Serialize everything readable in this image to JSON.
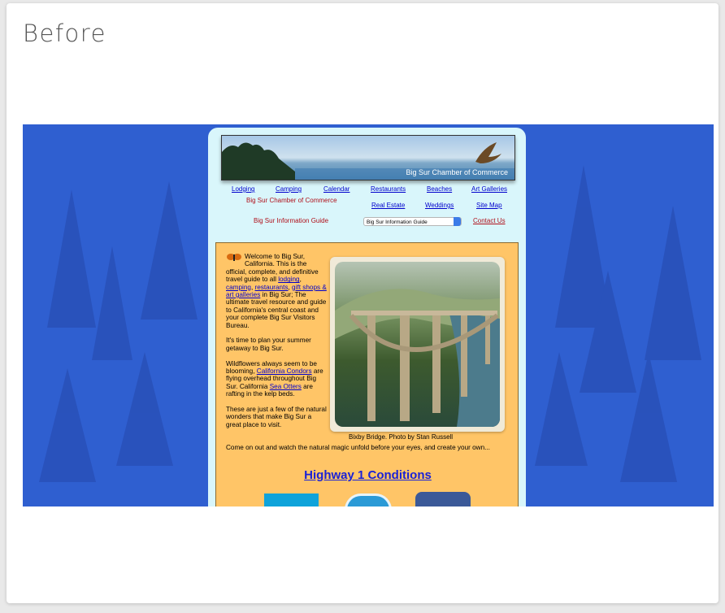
{
  "card": {
    "title": "Before"
  },
  "site": {
    "banner": {
      "text": "Big Sur Chamber of Commerce"
    },
    "nav": {
      "lodging": "Lodging",
      "camping": "Camping",
      "calendar": "Calendar",
      "restaurants": "Restaurants",
      "beaches": "Beaches",
      "art_galleries": "Art Galleries",
      "chamber": "Big Sur Chamber of Commerce",
      "real_estate": "Real Estate",
      "weddings": "Weddings",
      "site_map": "Site Map",
      "info_guide": "Big Sur Information Guide",
      "select_value": "Big Sur Information Guide",
      "contact_us": "Contact Us"
    },
    "welcome": {
      "p1_a": "Welcome to Big Sur, California. This is the official, complete, and definitive travel guide to all ",
      "link_lodging": "lodging",
      "sep1": ", ",
      "link_camping": "camping",
      "sep2": ", ",
      "link_restaurants": "restaurants",
      "sep3": ", ",
      "link_gifts": "gift shops & art galleries",
      "p1_b": " in Big Sur; The ultimate travel resource and guide to California's central coast and your complete Big Sur Visitors Bureau.",
      "p2": "It's time to plan your summer getaway to Big Sur.",
      "p3_a": "Wildflowers always seem to be blooming, ",
      "link_condors": "California Condors",
      "p3_b": " are flying overhead throughout Big Sur. California ",
      "link_otters": "Sea Otters",
      "p3_c": " are rafting in the kelp beds.",
      "p4": "These are just a few of the natural wonders that make Big Sur a great place to visit.",
      "p5": "Come on out and watch the natural magic unfold before your eyes, and create your own..."
    },
    "photo_caption": "Bixby Bridge. Photo by Stan Russell",
    "highway_link": "Highway 1 Conditions"
  },
  "colors": {
    "background_blue": "#2f5fd0",
    "site_bg": "#d9f6fb",
    "content_bg": "#ffc567",
    "link": "#0000cc",
    "nav_red": "#b0101a"
  }
}
